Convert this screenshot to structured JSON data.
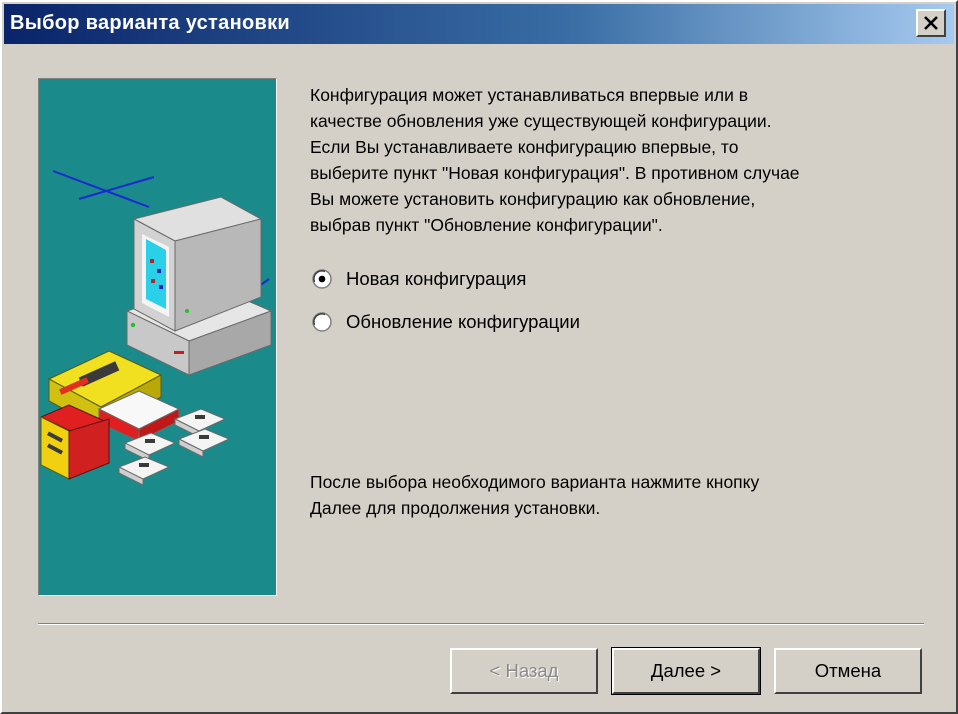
{
  "window": {
    "title": "Выбор варианта установки"
  },
  "icons": {
    "close": "close-icon",
    "illustration": "computer-setup-illustration"
  },
  "description": "Конфигурация может устанавливаться впервые или в\nкачестве обновления уже существующей конфигурации.\nЕсли Вы устанавливаете конфигурацию впервые, то\nвыберите пункт \"Новая конфигурация\". В противном случае\nВы можете установить конфигурацию как обновление,\nвыбрав пункт \"Обновление конфигурации\".",
  "options": [
    {
      "label": "Новая конфигурация",
      "selected": true
    },
    {
      "label": "Обновление конфигурации",
      "selected": false
    }
  ],
  "hint": "После выбора необходимого варианта нажмите кнопку\nДалее для продолжения установки.",
  "buttons": {
    "back": "< Назад",
    "next": "Далее >",
    "cancel": "Отмена"
  },
  "colors": {
    "title_gradient_start": "#0a246a",
    "title_gradient_end": "#a6caf0",
    "dialog_bg": "#d4d0c8",
    "illustration_bg": "#1a8a8a"
  }
}
